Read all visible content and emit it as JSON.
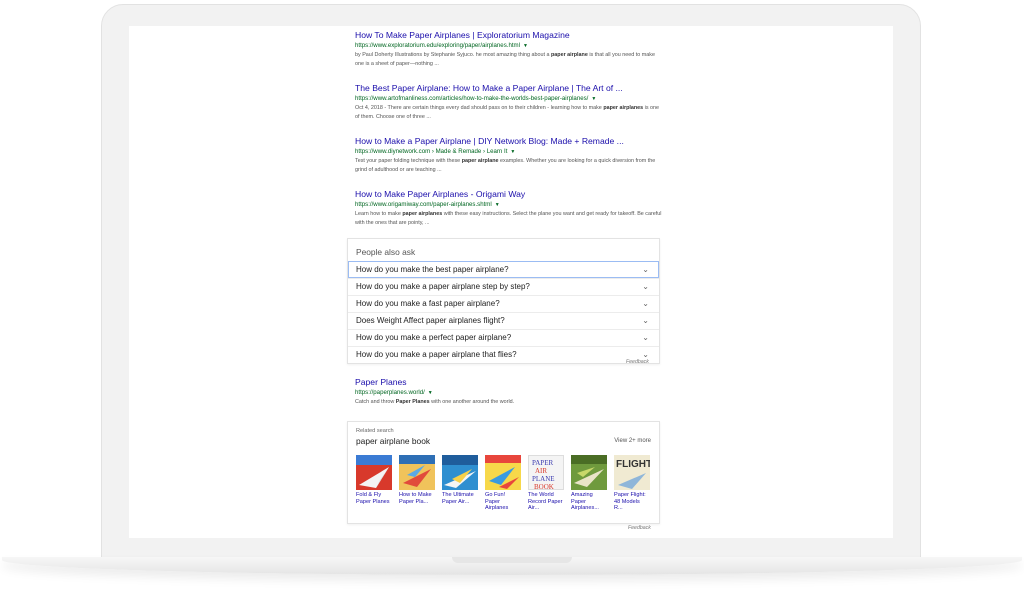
{
  "results": [
    {
      "title": "How To Make Paper Airplanes | Exploratorium Magazine",
      "url": "https://www.exploratorium.edu/exploring/paper/airplanes.html",
      "snippet_1": "by Paul Doherty Illustrations by Stephanie Syjuco. he most amazing thing about a ",
      "snippet_bold_1": "paper airplane",
      "snippet_2": " is that all you need to make one is a sheet of paper—nothing ..."
    },
    {
      "title": "The Best Paper Airplane: How to Make a Paper Airplane | The Art of ...",
      "url": "https://www.artofmanliness.com/articles/how-to-make-the-worlds-best-paper-airplanes/",
      "snippet_1": "Oct 4, 2018 - There are certain things every dad should pass on to their children - learning how to make ",
      "snippet_bold_1": "paper airplanes",
      "snippet_2": " is one of them. Choose one of three ..."
    },
    {
      "title": "How to Make a Paper Airplane | DIY Network Blog: Made + Remade ...",
      "url": "https://www.diynetwork.com › Made & Remade › Learn It",
      "snippet_1": "Test your paper folding technique with these ",
      "snippet_bold_1": "paper airplane",
      "snippet_2": " examples. Whether you are looking for a quick diversion from the grind of adulthood or are teaching ..."
    },
    {
      "title": "How to Make Paper Airplanes - Origami Way",
      "url": "https://www.origamiway.com/paper-airplanes.shtml",
      "snippet_1": "Learn how to make ",
      "snippet_bold_1": "paper airplanes",
      "snippet_2": " with these easy instructions. Select the plane you want and get ready for takeoff. Be careful with the ones that are pointy, ..."
    }
  ],
  "people_also_ask": {
    "heading": "People also ask",
    "questions": [
      "How do you make the best paper airplane?",
      "How do you make a paper airplane step by step?",
      "How do you make a fast paper airplane?",
      "Does Weight Affect paper airplanes flight?",
      "How do you make a perfect paper airplane?",
      "How do you make a paper airplane that flies?"
    ],
    "feedback": "Feedback"
  },
  "result_paper_planes": {
    "title": "Paper Planes",
    "url": "https://paperplanes.world/",
    "snippet_1": "Catch and throw ",
    "snippet_bold_1": "Paper Planes",
    "snippet_2": " with one another around the world."
  },
  "related": {
    "label": "Related search",
    "query": "paper airplane book",
    "more": "View 2+ more",
    "feedback": "Feedback",
    "books": [
      {
        "title": "Fold & Fly Paper Planes",
        "cover_text": "Fold Fly",
        "color": "#d8392b"
      },
      {
        "title": "How to Make Paper Pla...",
        "cover_text": "",
        "color": "#e9b44a"
      },
      {
        "title": "The Ultimate Paper Air...",
        "cover_text": "PAPER AIRPLANE",
        "color": "#2f8fd0"
      },
      {
        "title": "Go Fun! Paper Airplanes",
        "cover_text": "",
        "color": "#e8463c"
      },
      {
        "title": "The World Record Paper Air...",
        "cover_text": "PAPER AIR PLANE BOOK",
        "color": "#f4f4f4"
      },
      {
        "title": "Amazing Paper Airplanes...",
        "cover_text": "PAPER AIRPLANES",
        "color": "#6f9a3d"
      },
      {
        "title": "Paper Flight: 48 Models R...",
        "cover_text": "FLIGHT",
        "color": "#f0ead2"
      }
    ]
  }
}
